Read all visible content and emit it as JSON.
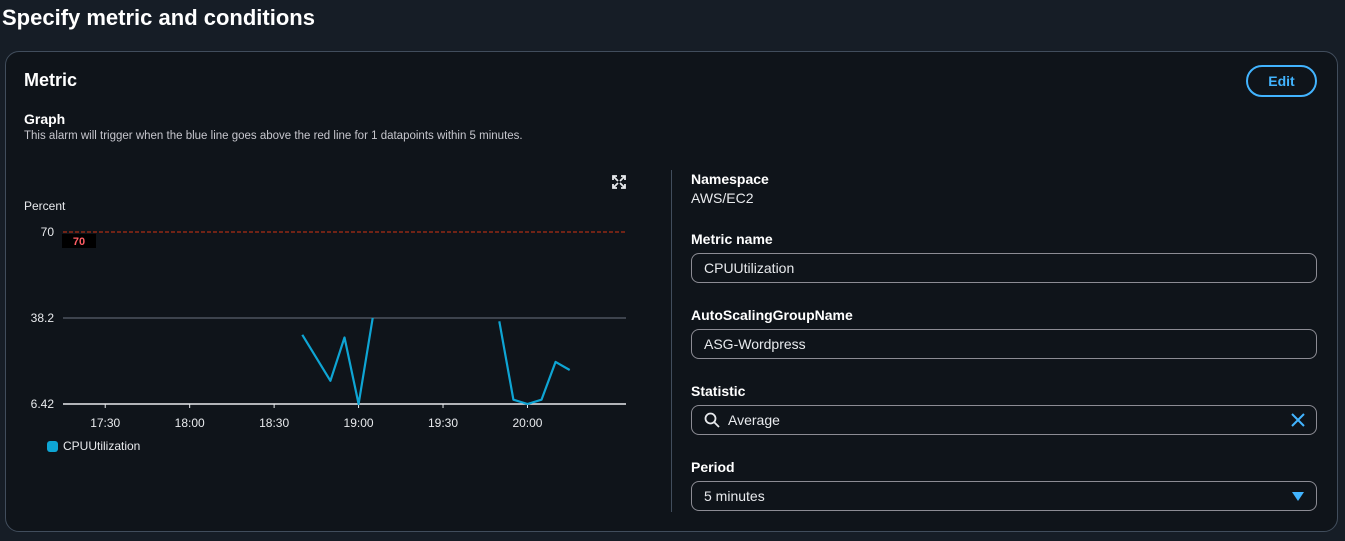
{
  "page_title": "Specify metric and conditions",
  "metric_panel": {
    "title": "Metric",
    "edit_label": "Edit",
    "graph_label": "Graph",
    "graph_description": "This alarm will trigger when the blue line goes above the red line for 1 datapoints within 5 minutes."
  },
  "fields": {
    "namespace_label": "Namespace",
    "namespace_value": "AWS/EC2",
    "metric_name_label": "Metric name",
    "metric_name_value": "CPUUtilization",
    "asg_label": "AutoScalingGroupName",
    "asg_value": "ASG-Wordpress",
    "statistic_label": "Statistic",
    "statistic_value": "Average",
    "period_label": "Period",
    "period_value": "5 minutes"
  },
  "icons": {
    "expand": "expand-icon",
    "search": "search-icon",
    "clear": "close-icon",
    "dropdown": "caret-down-icon"
  },
  "colors": {
    "series": "#0ea5d4",
    "threshold": "#d13212",
    "accent": "#42b4ff"
  },
  "chart_data": {
    "type": "line",
    "ylabel": "Percent",
    "y_ticks": [
      "70",
      "38.2",
      "6.42"
    ],
    "y_tick_values": [
      70,
      38.2,
      6.42
    ],
    "ylim": [
      6.42,
      70
    ],
    "x_ticks": [
      "17:30",
      "18:00",
      "18:30",
      "19:00",
      "19:30",
      "20:00"
    ],
    "x_tick_minutes": [
      1050,
      1080,
      1110,
      1140,
      1170,
      1200
    ],
    "xlim_minutes": [
      1035,
      1235
    ],
    "threshold": {
      "value": 70,
      "label": "70"
    },
    "series": [
      {
        "name": "CPUUtilization",
        "segments": [
          [
            [
              1120,
              32
            ],
            [
              1130,
              15
            ],
            [
              1135,
              31
            ],
            [
              1140,
              6.42
            ],
            [
              1145,
              38.2
            ]
          ],
          [
            [
              1190,
              37
            ],
            [
              1195,
              8
            ],
            [
              1200,
              6.42
            ],
            [
              1205,
              8
            ],
            [
              1210,
              22
            ],
            [
              1215,
              19
            ]
          ]
        ]
      }
    ],
    "legend_position": "bottom-left",
    "grid": true
  }
}
